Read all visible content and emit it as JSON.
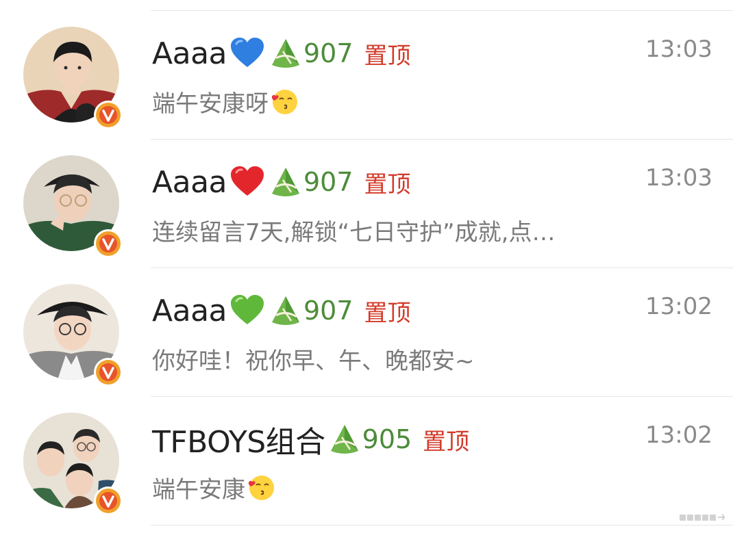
{
  "conversations": [
    {
      "name": "Aaaa",
      "heart": "blue-heart",
      "heart_color": "#2f7fe0",
      "level": "907",
      "pin": "置顶",
      "time": "13:03",
      "message": "端午安康呀",
      "message_emoji": "kiss-emoji"
    },
    {
      "name": "Aaaa",
      "heart": "red-heart",
      "heart_color": "#e3262c",
      "level": "907",
      "pin": "置顶",
      "time": "13:03",
      "message": "连续留言7天,解锁“七日守护”成就,点…",
      "message_emoji": ""
    },
    {
      "name": "Aaaa",
      "heart": "green-heart",
      "heart_color": "#5fb83a",
      "level": "907",
      "pin": "置顶",
      "time": "13:02",
      "message": "你好哇！祝你早、午、晚都安~",
      "message_emoji": ""
    },
    {
      "name": "TFBOYS组合",
      "heart": "",
      "heart_color": "",
      "level": "905",
      "pin": "置顶",
      "time": "13:02",
      "message": "端午安康",
      "message_emoji": "kiss-emoji"
    }
  ],
  "colors": {
    "level_green": "#4c8c39",
    "pin_red": "#d23b2a",
    "badge_orange": "#f0a02a"
  },
  "icons": {
    "level_badge": "zongzi-icon",
    "verified_badge": "verified-v-icon"
  }
}
